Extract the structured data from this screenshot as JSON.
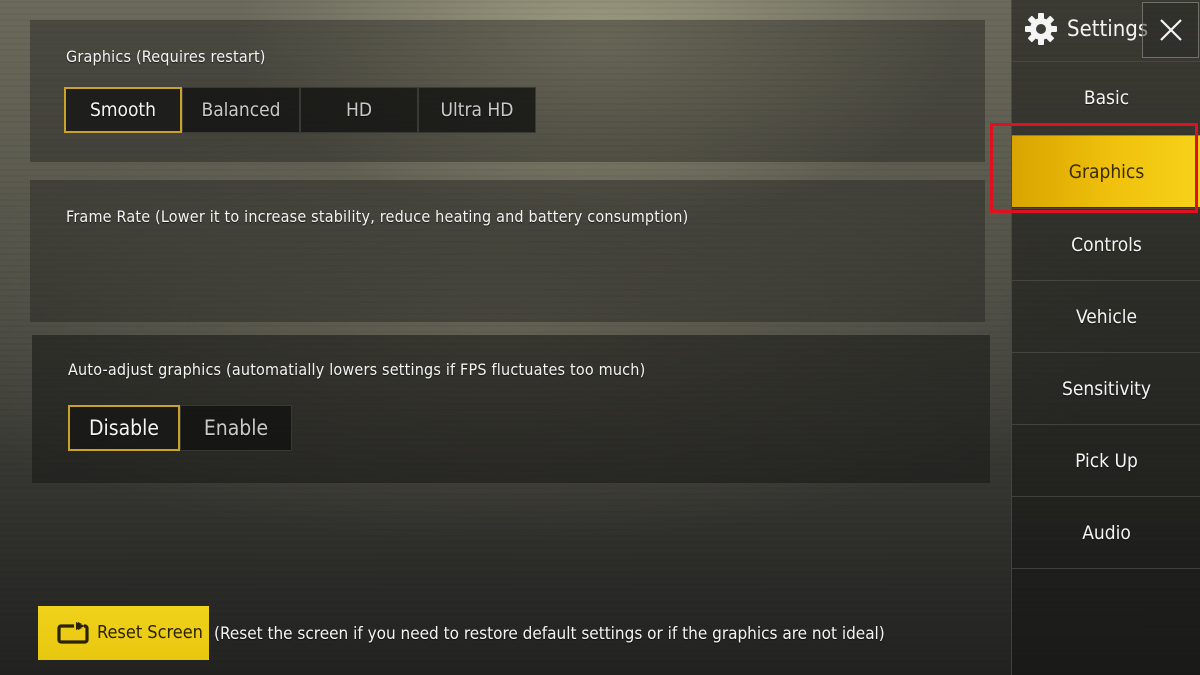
{
  "sidebar": {
    "title": "Settings",
    "items": [
      {
        "label": "Basic"
      },
      {
        "label": "Graphics"
      },
      {
        "label": "Controls"
      },
      {
        "label": "Vehicle"
      },
      {
        "label": "Sensitivity"
      },
      {
        "label": "Pick Up"
      },
      {
        "label": "Audio"
      }
    ],
    "active_item": "Graphics"
  },
  "graphics_panel": {
    "title": "Graphics (Requires restart)",
    "options": [
      "Smooth",
      "Balanced",
      "HD",
      "Ultra HD"
    ],
    "selected": "Smooth"
  },
  "frame_rate_panel": {
    "title": "Frame Rate (Lower it to increase stability, reduce heating and battery consumption)"
  },
  "auto_adjust_panel": {
    "title": "Auto-adjust graphics (automatially lowers settings if FPS fluctuates too much)",
    "options": [
      "Disable",
      "Enable"
    ],
    "selected": "Disable"
  },
  "reset": {
    "label": "Reset Screen",
    "note": "(Reset the screen if you need to restore default settings or if the graphics are not ideal)"
  },
  "icons": {
    "settings": "gear-icon",
    "close": "close-icon",
    "reset": "reset-screen-icon"
  },
  "colors": {
    "accent_yellow": "#f0c20d",
    "selected_border": "#c9a227",
    "highlight_red": "#e0101e"
  }
}
